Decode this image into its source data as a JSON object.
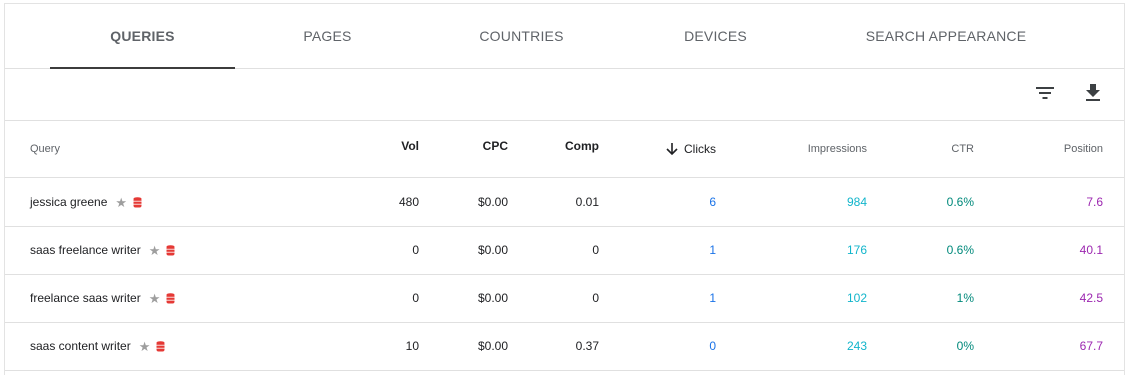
{
  "tabs": [
    {
      "label": "QUERIES",
      "active": true
    },
    {
      "label": "PAGES",
      "active": false
    },
    {
      "label": "COUNTRIES",
      "active": false
    },
    {
      "label": "DEVICES",
      "active": false
    },
    {
      "label": "SEARCH APPEARANCE",
      "active": false
    }
  ],
  "toolbar": {
    "filter_icon": "filter-icon",
    "download_icon": "download-icon"
  },
  "columns": {
    "query": "Query",
    "vol": "Vol",
    "cpc": "CPC",
    "comp": "Comp",
    "clicks": "Clicks",
    "impressions": "Impressions",
    "ctr": "CTR",
    "position": "Position"
  },
  "sort": {
    "column": "clicks",
    "direction": "descending",
    "icon": "arrow-down-icon"
  },
  "rows": [
    {
      "query": "jessica greene",
      "vol": "480",
      "cpc": "$0.00",
      "comp": "0.01",
      "clicks": "6",
      "impressions": "984",
      "ctr": "0.6%",
      "position": "7.6"
    },
    {
      "query": "saas freelance writer",
      "vol": "0",
      "cpc": "$0.00",
      "comp": "0",
      "clicks": "1",
      "impressions": "176",
      "ctr": "0.6%",
      "position": "40.1"
    },
    {
      "query": "freelance saas writer",
      "vol": "0",
      "cpc": "$0.00",
      "comp": "0",
      "clicks": "1",
      "impressions": "102",
      "ctr": "1%",
      "position": "42.5"
    },
    {
      "query": "saas content writer",
      "vol": "10",
      "cpc": "$0.00",
      "comp": "0.37",
      "clicks": "0",
      "impressions": "243",
      "ctr": "0%",
      "position": "67.7"
    }
  ],
  "colors": {
    "clicks": "#1a73e8",
    "impressions": "#12b5cb",
    "ctr": "#00897b",
    "position": "#9c27b0",
    "db_icon": "#e53935",
    "star_icon": "#9e9e9e"
  }
}
